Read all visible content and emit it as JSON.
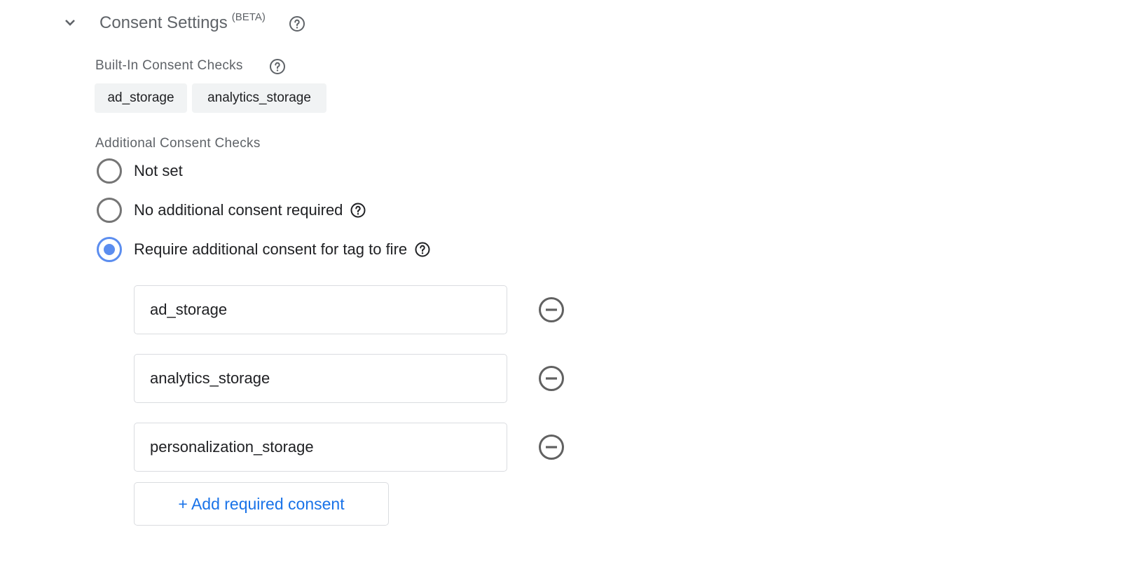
{
  "section": {
    "title": "Consent Settings",
    "badge": "(BETA)",
    "expanded": true
  },
  "builtin": {
    "label": "Built-In Consent Checks",
    "chips": [
      "ad_storage",
      "analytics_storage"
    ]
  },
  "additional": {
    "label": "Additional Consent Checks",
    "options": [
      {
        "label": "Not set",
        "checked": false,
        "help": false
      },
      {
        "label": "No additional consent required",
        "checked": false,
        "help": true
      },
      {
        "label": "Require additional consent for tag to fire",
        "checked": true,
        "help": true
      }
    ],
    "required_consents": [
      "ad_storage",
      "analytics_storage",
      "personalization_storage"
    ],
    "add_button_label": "+ Add required consent"
  },
  "colors": {
    "accent": "#5b8def",
    "link": "#1a73e8",
    "chip_bg": "#f1f3f4",
    "muted_text": "#5f6368"
  },
  "icons": {
    "expand": "chevron-down-icon",
    "help": "help-circle-icon",
    "remove": "minus-circle-icon"
  }
}
